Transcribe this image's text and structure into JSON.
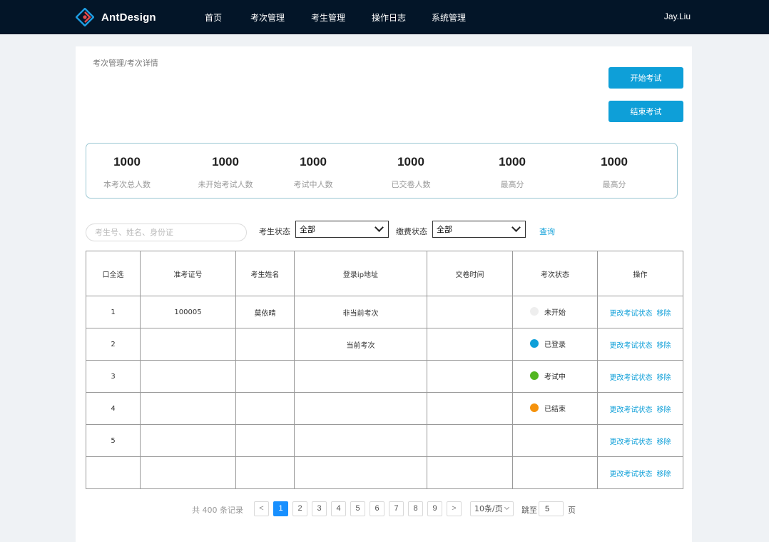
{
  "header": {
    "brand": "AntDesign",
    "nav": [
      "首页",
      "考次管理",
      "考生管理",
      "操作日志",
      "系统管理"
    ],
    "user": "Jay.Liu"
  },
  "breadcrumb": {
    "parent": "考次管理",
    "separator": "/",
    "current": "考次详情"
  },
  "actions": {
    "start_exam": "开始考试",
    "end_exam": "结束考试"
  },
  "stats": [
    {
      "value": "1000",
      "label": "本考次总人数"
    },
    {
      "value": "1000",
      "label": "未开始考试人数"
    },
    {
      "value": "1000",
      "label": "考试中人数"
    },
    {
      "value": "1000",
      "label": "已交卷人数"
    },
    {
      "value": "1000",
      "label": "最高分"
    },
    {
      "value": "1000",
      "label": "最高分"
    }
  ],
  "filters": {
    "search_placeholder": "考生号、姓名、身份证",
    "exam_status_label": "考生状态",
    "exam_status_value": "全部",
    "payment_status_label": "缴费状态",
    "payment_status_value": "全部",
    "query": "查询"
  },
  "table": {
    "columns": [
      "口全选",
      "准考证号",
      "考生姓名",
      "登录ip地址",
      "交卷时间",
      "考次状态",
      "操作"
    ],
    "rows": [
      {
        "no": "1",
        "ticket": "100005",
        "name": "莫依晴",
        "ip": "非当前考次",
        "submit": "",
        "status": "未开始",
        "status_color": "#eeeeee"
      },
      {
        "no": "2",
        "ticket": "",
        "name": "",
        "ip": "当前考次",
        "submit": "",
        "status": "已登录",
        "status_color": "#0e9fd8"
      },
      {
        "no": "3",
        "ticket": "",
        "name": "",
        "ip": "",
        "submit": "",
        "status": "考试中",
        "status_color": "#52b621"
      },
      {
        "no": "4",
        "ticket": "",
        "name": "",
        "ip": "",
        "submit": "",
        "status": "已结束",
        "status_color": "#f5920c"
      },
      {
        "no": "5",
        "ticket": "",
        "name": "",
        "ip": "",
        "submit": "",
        "status": "",
        "status_color": ""
      },
      {
        "no": "",
        "ticket": "",
        "name": "",
        "ip": "",
        "submit": "",
        "status": "",
        "status_color": ""
      }
    ],
    "op_change": "更改考试状态",
    "op_remove": "移除"
  },
  "pagination": {
    "total": "共 400 条记录",
    "prev": "<",
    "next": ">",
    "pages": [
      "1",
      "2",
      "3",
      "4",
      "5",
      "6",
      "7",
      "8",
      "9"
    ],
    "current_page": "1",
    "page_size": "10条/页",
    "jump_label": "跳至",
    "jump_value": "5",
    "page_suffix": "页"
  },
  "colors": {
    "topbar": "#031528",
    "primary": "#0e9fd8",
    "active_page": "#1890ff",
    "logo_red": "#e84a4a",
    "logo_blue": "#1e9be0"
  }
}
